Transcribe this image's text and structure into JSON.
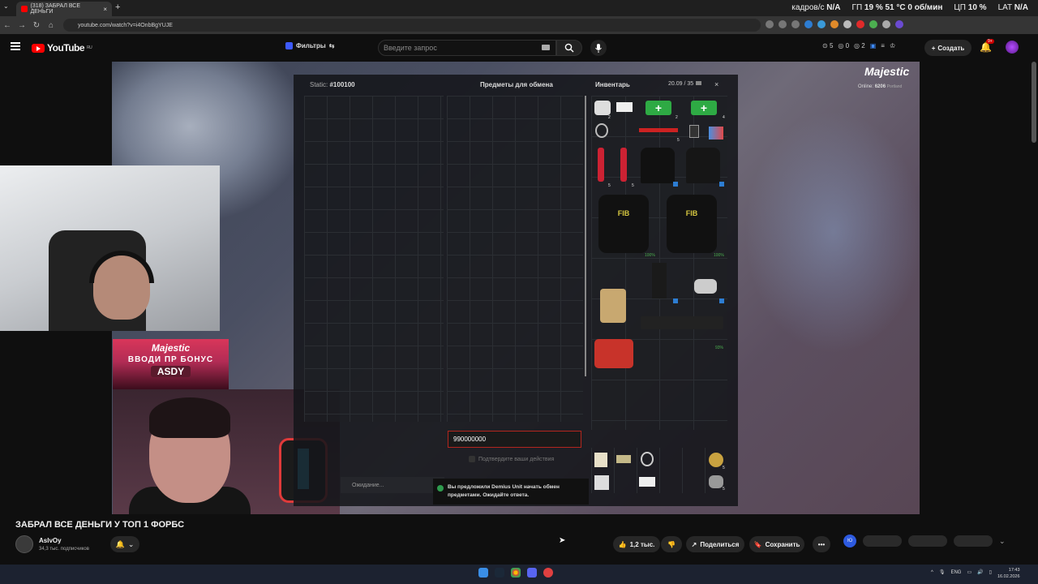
{
  "browser": {
    "tab_title": "(318) ЗАБРАЛ ВСЕ ДЕНЬГИ",
    "url": "youtube.com/watch?v=i4OnbBgYUJE",
    "stats": [
      {
        "label": "кадров/с",
        "value": "N/A"
      },
      {
        "label": "ГП",
        "value": "19 % 51 °C 0 об/мин"
      },
      {
        "label": "ЦП",
        "value": "10 %"
      },
      {
        "label": "LAT",
        "value": "N/A"
      }
    ]
  },
  "youtube": {
    "logo_text": "YouTube",
    "logo_region": "RU",
    "filters_label": "Фильтры",
    "search_placeholder": "Введите запрос",
    "counters": [
      "5",
      "0",
      "2"
    ],
    "create_label": "Создать",
    "notif_count": "9+"
  },
  "game": {
    "static_label": "Static:",
    "static_id": "#100100",
    "trade_title": "Предметы для обмена",
    "inventory_title": "Инвентарь",
    "weight": "20.09 / 35",
    "amount_value": "990000000",
    "confirm_text": "Подтвердите ваши действия",
    "waiting_text": "Ожидание...",
    "toast_text": "Вы предложили Demius Unit начать обмен предметами. Ожидайте ответа.",
    "brand": "Majestic",
    "online_label": "Online:",
    "online_value": "6206",
    "server": "Portland",
    "items": {
      "qty_2a": "2",
      "qty_2b": "2",
      "qty_4": "4",
      "qty_5a": "5",
      "qty_5b": "5",
      "qty_5c": "5",
      "qty_5d": "5",
      "qty_5e": "5",
      "pct_vest1": "100%",
      "pct_vest2": "100%",
      "pct_gun": "93%"
    }
  },
  "promo": {
    "brand": "Majestic",
    "line": "ВВОДИ ПР БОНУС",
    "code": "ASDY"
  },
  "video_info": {
    "title": "ЗАБРАЛ ВСЕ ДЕНЬГИ У ТОП 1 ФОРБС",
    "channel": "AslvOy",
    "subscribers": "34,3 тыс. подписчиков",
    "likes": "1,2 тыс.",
    "share": "Поделиться",
    "save": "Сохранить",
    "next_badge": "Ю"
  },
  "taskbar": {
    "lang": "ENG",
    "time": "17:43",
    "date": "16.02.2026"
  }
}
